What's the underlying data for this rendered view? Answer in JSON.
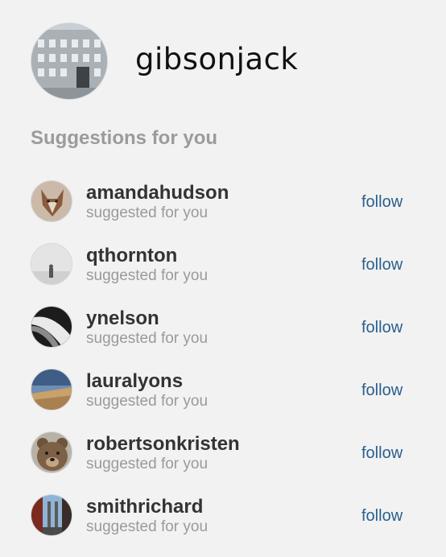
{
  "profile": {
    "username": "gibsonjack",
    "avatar_icon": "building-photo-icon"
  },
  "suggestions": {
    "heading": "Suggestions for you",
    "items": [
      {
        "name": "amandahudson",
        "subtitle": "suggested for you",
        "action": "follow",
        "avatar_icon": "fox-photo-icon"
      },
      {
        "name": "qthornton",
        "subtitle": "suggested for you",
        "action": "follow",
        "avatar_icon": "misty-figure-photo-icon"
      },
      {
        "name": "ynelson",
        "subtitle": "suggested for you",
        "action": "follow",
        "avatar_icon": "abstract-curve-photo-icon"
      },
      {
        "name": "lauralyons",
        "subtitle": "suggested for you",
        "action": "follow",
        "avatar_icon": "desert-landscape-photo-icon"
      },
      {
        "name": "robertsonkristen",
        "subtitle": "suggested for you",
        "action": "follow",
        "avatar_icon": "bear-photo-icon"
      },
      {
        "name": "smithrichard",
        "subtitle": "suggested for you",
        "action": "follow",
        "avatar_icon": "bridge-city-photo-icon"
      }
    ]
  },
  "colors": {
    "background": "#f2f2f2",
    "link": "#2a5f8f",
    "heading": "#9b9b9b",
    "name": "#333333",
    "subtitle": "#9a9a9a"
  }
}
